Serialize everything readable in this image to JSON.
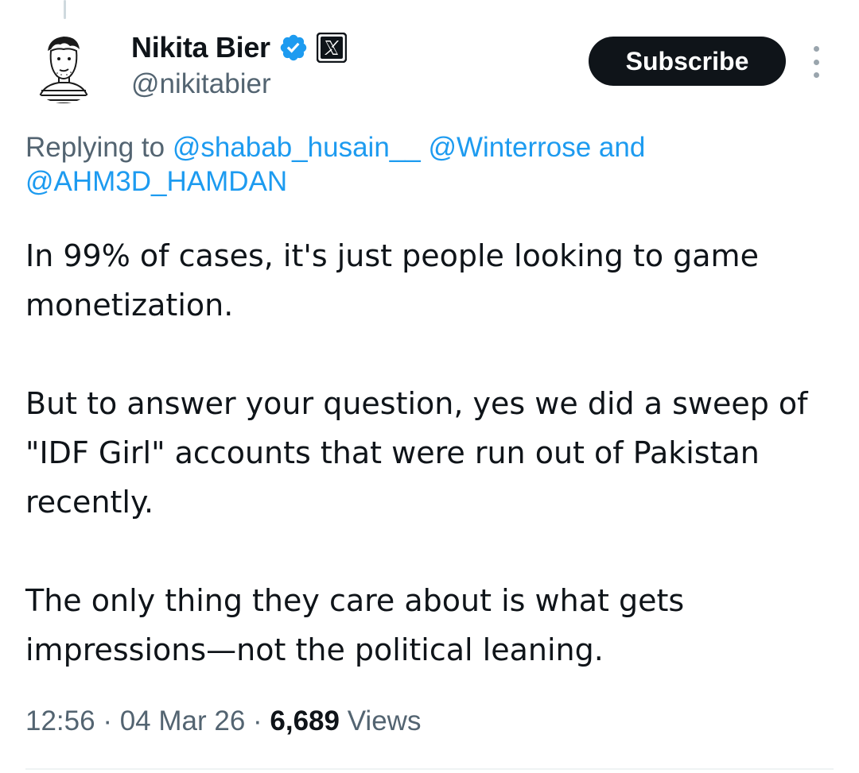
{
  "author": {
    "display_name": "Nikita Bier",
    "handle": "@nikitabier",
    "verified": true,
    "affiliate_badge": "x-logo-icon"
  },
  "actions": {
    "subscribe_label": "Subscribe",
    "more_icon": "more-vertical-icon"
  },
  "reply_context": {
    "prefix": "Replying to ",
    "mentions": [
      "@shabab_husain__",
      "@Winterrose",
      "@AHM3D_HAMDAN"
    ],
    "joiner_space": " ",
    "joiner_and": " and"
  },
  "tweet": {
    "paragraphs": [
      "In 99% of cases, it's just people looking to game monetization.",
      "But to answer your question, yes we did a sweep of \"IDF Girl\" accounts that were run out of Pakistan recently.",
      "The only thing they care about is what gets impressions—not the political leaning."
    ]
  },
  "meta": {
    "time": "12:56",
    "separator": " · ",
    "date": "04 Mar 26",
    "views_count": "6,689",
    "views_label": " Views"
  },
  "colors": {
    "link": "#1d9bf0",
    "secondary_text": "#536471",
    "primary_text": "#0f1419",
    "button_bg": "#0f1419"
  }
}
